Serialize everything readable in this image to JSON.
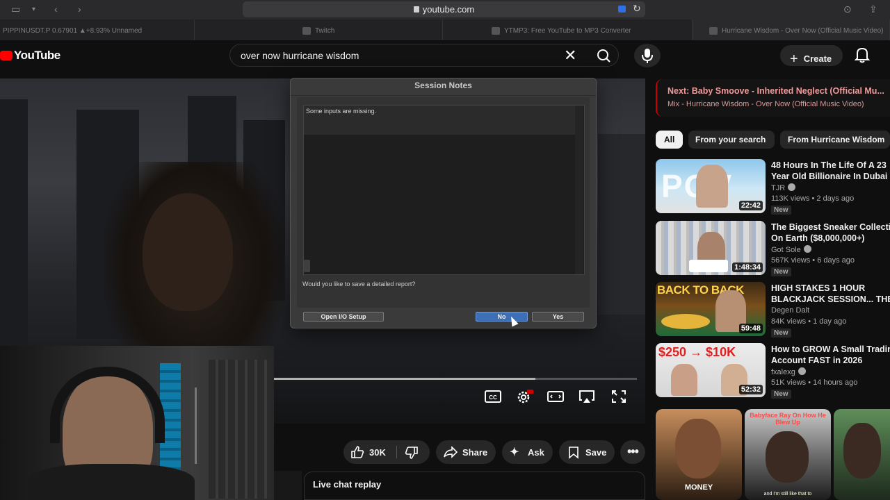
{
  "browser": {
    "url": "youtube.com",
    "tabs": [
      {
        "label": "PIPPINUSDT.P 0.67901 ▲+8.93% Unnamed"
      },
      {
        "label": "Twitch"
      },
      {
        "label": "YTMP3: Free YouTube to MP3 Converter"
      },
      {
        "label": "Hurricane Wisdom - Over Now (Official Music Video)"
      }
    ]
  },
  "header": {
    "logo": "YouTube",
    "search_query": "over now hurricane wisdom",
    "create_label": "Create"
  },
  "dialog": {
    "title": "Session Notes",
    "message": "Some inputs are missing.",
    "question": "Would you like to save a detailed report?",
    "btn_io": "Open I/O Setup",
    "btn_no": "No",
    "btn_yes": "Yes"
  },
  "player": {
    "progress_fraction": 0.72
  },
  "actions": {
    "likes": "30K",
    "share": "Share",
    "ask": "Ask",
    "save": "Save",
    "live_chat": "Live chat replay"
  },
  "sidebar": {
    "up_next_title": "Next: Baby Smoove - Inherited Neglect (Official Mu...",
    "up_next_sub": "Mix - Hurricane Wisdom - Over Now (Official Music Video)",
    "chips": [
      "All",
      "From your search",
      "From Hurricane Wisdom"
    ],
    "recommendations": [
      {
        "title1": "48 Hours In The Life Of A 23",
        "title2": "Year Old Billionaire In Dubai",
        "channel": "TJR",
        "meta": "113K views • 2 days ago",
        "badge": "New",
        "duration": "22:42",
        "thumb_text": "POV"
      },
      {
        "title1": "The Biggest Sneaker Collection",
        "title2": "On Earth ($8,000,000+)",
        "channel": "Got Sole",
        "meta": "567K views • 6 days ago",
        "badge": "New",
        "duration": "1:48:34",
        "thumb_text": ""
      },
      {
        "title1": "HIGH STAKES 1 HOUR",
        "title2": "BLACKJACK SESSION... THE",
        "channel": "Degen Dalt",
        "meta": "84K views • 1 day ago",
        "badge": "New",
        "duration": "59:48",
        "thumb_text": "BACK TO BACK"
      },
      {
        "title1": "How to GROW A Small Trading",
        "title2": "Account FAST in 2026",
        "channel": "fxalexg",
        "meta": "51K views • 14 hours ago",
        "badge": "New",
        "duration": "52:32",
        "thumb_text": "$250 → $10K"
      }
    ],
    "shorts": [
      {
        "label": "MONEY",
        "top": "",
        "caption": ""
      },
      {
        "label": "",
        "top": "Babyface Ray On How He Blew Up",
        "caption": "and I'm still like that to"
      },
      {
        "label": "",
        "top": "",
        "caption": ""
      }
    ]
  },
  "colors": {
    "accent": "#ff0000",
    "dialog_primary": "#3d6fb6"
  }
}
